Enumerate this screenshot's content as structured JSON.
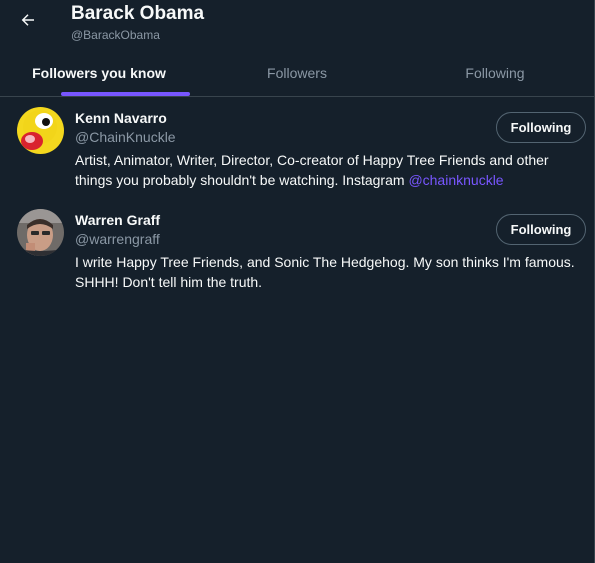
{
  "header": {
    "title": "Barack Obama",
    "handle": "@BarackObama"
  },
  "tabs": [
    {
      "label": "Followers you know",
      "active": true
    },
    {
      "label": "Followers",
      "active": false
    },
    {
      "label": "Following",
      "active": false
    }
  ],
  "users": [
    {
      "name": "Kenn Navarro",
      "handle": "@ChainKnuckle",
      "bio_text": "Artist, Animator, Writer, Director, Co-creator of Happy Tree Friends and other things you probably shouldn't be watching. Instagram ",
      "bio_mention": "@chainknuckle",
      "button_label": "Following"
    },
    {
      "name": "Warren Graff",
      "handle": "@warrengraff",
      "bio_text": "I write Happy Tree Friends, and Sonic The Hedgehog. My son thinks I'm famous. SHHH! Don't tell him the truth.",
      "button_label": "Following"
    }
  ],
  "colors": {
    "background": "#15202b",
    "accent": "#7856ff",
    "secondary_text": "#8b98a5",
    "border": "#38444d"
  }
}
